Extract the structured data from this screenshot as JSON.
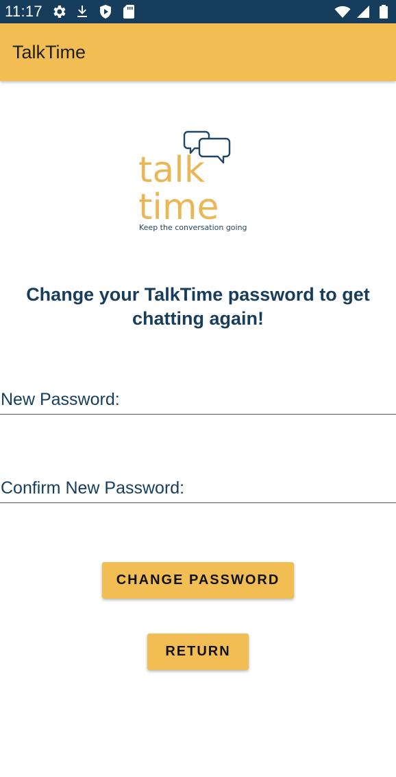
{
  "status_bar": {
    "time": "11:17",
    "left_icons": [
      "settings-icon",
      "download-icon",
      "shield-play-icon",
      "sd-card-icon"
    ],
    "right_icons": [
      "wifi-icon",
      "cellular-signal-icon",
      "battery-icon"
    ],
    "background": "#173d5c"
  },
  "app_bar": {
    "title": "TalkTime",
    "background": "#f2bd52"
  },
  "logo": {
    "word_top": "talk",
    "word_bottom": "time",
    "tagline": "Keep the conversation going",
    "accent_color": "#eab756",
    "navy_color": "#1f4566"
  },
  "headline": "Change your TalkTime password to get chatting again!",
  "form": {
    "new_password_label": "New Password:",
    "confirm_password_label": "Confirm New Password:"
  },
  "buttons": {
    "change_password": "CHANGE PASSWORD",
    "return": "RETURN"
  }
}
